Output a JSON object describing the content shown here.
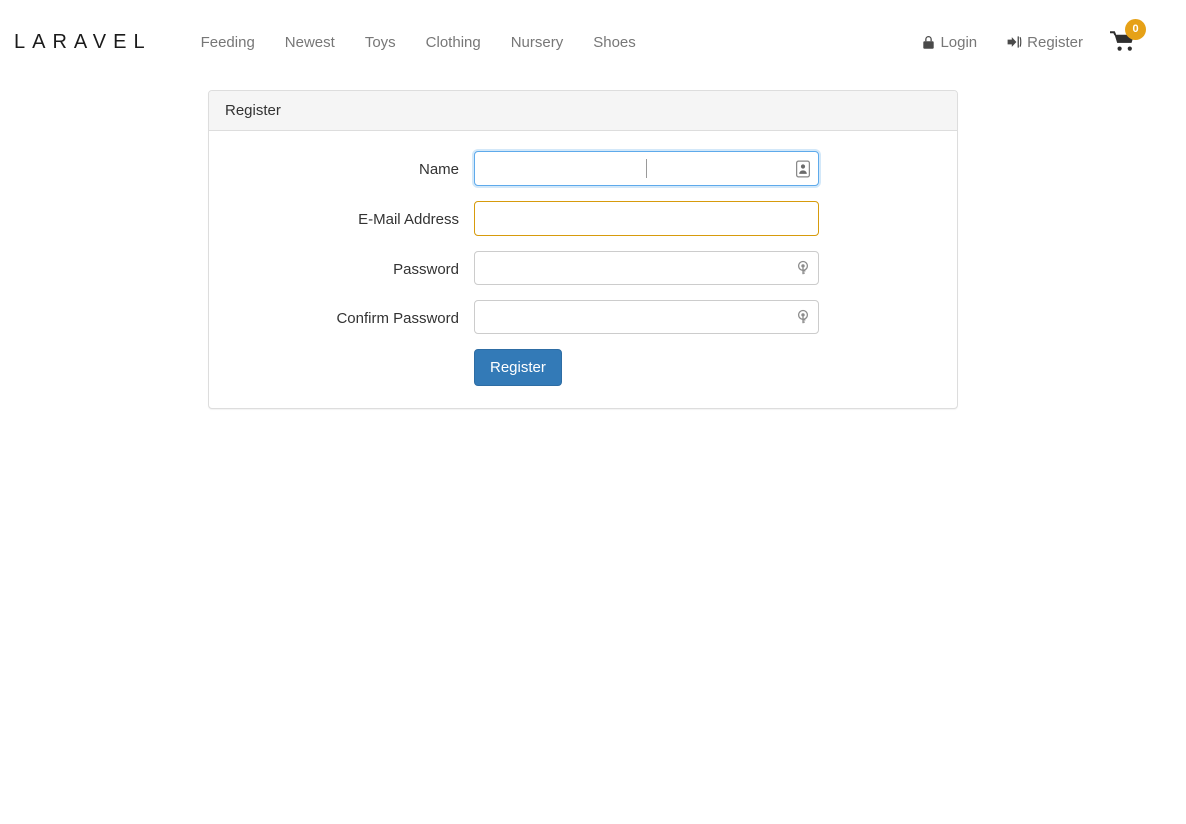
{
  "navbar": {
    "brand": "LARAVEL",
    "links": [
      {
        "label": "Feeding",
        "icon": ""
      },
      {
        "label": "Newest",
        "icon": ""
      },
      {
        "label": "Toys",
        "icon": ""
      },
      {
        "label": "Clothing",
        "icon": ""
      },
      {
        "label": "Nursery",
        "icon": ""
      },
      {
        "label": "Shoes",
        "icon": ""
      }
    ],
    "right": [
      {
        "label": "Login",
        "icon": "lock-icon"
      },
      {
        "label": "Register",
        "icon": "sign-in-icon"
      }
    ],
    "cart": {
      "icon": "shopping-cart-icon",
      "badge_count": "0",
      "badge_color": "#e6a117"
    },
    "link_color": "#777777"
  },
  "card": {
    "header_title": "Register",
    "header_bg": "#f5f5f5",
    "border_color": "#dddddd"
  },
  "form": {
    "fields": [
      {
        "label": "Name",
        "value": "",
        "placeholder": "",
        "type": "text",
        "state": "focused",
        "border_color": "#5eaaeb",
        "icon": "contact-card-icon",
        "caret_visible": true
      },
      {
        "label": "E-Mail Address",
        "value": "",
        "placeholder": "",
        "type": "email",
        "state": "warning",
        "border_color": "#d79b0c",
        "icon": "",
        "caret_visible": false
      },
      {
        "label": "Password",
        "value": "",
        "placeholder": "",
        "type": "password",
        "state": "default",
        "border_color": "#cccccc",
        "icon": "key-icon",
        "caret_visible": false
      },
      {
        "label": "Confirm Password",
        "value": "",
        "placeholder": "",
        "type": "password",
        "state": "default",
        "border_color": "#cccccc",
        "icon": "key-icon",
        "caret_visible": false
      }
    ],
    "submit_label": "Register",
    "submit_color": "#337ab7"
  }
}
